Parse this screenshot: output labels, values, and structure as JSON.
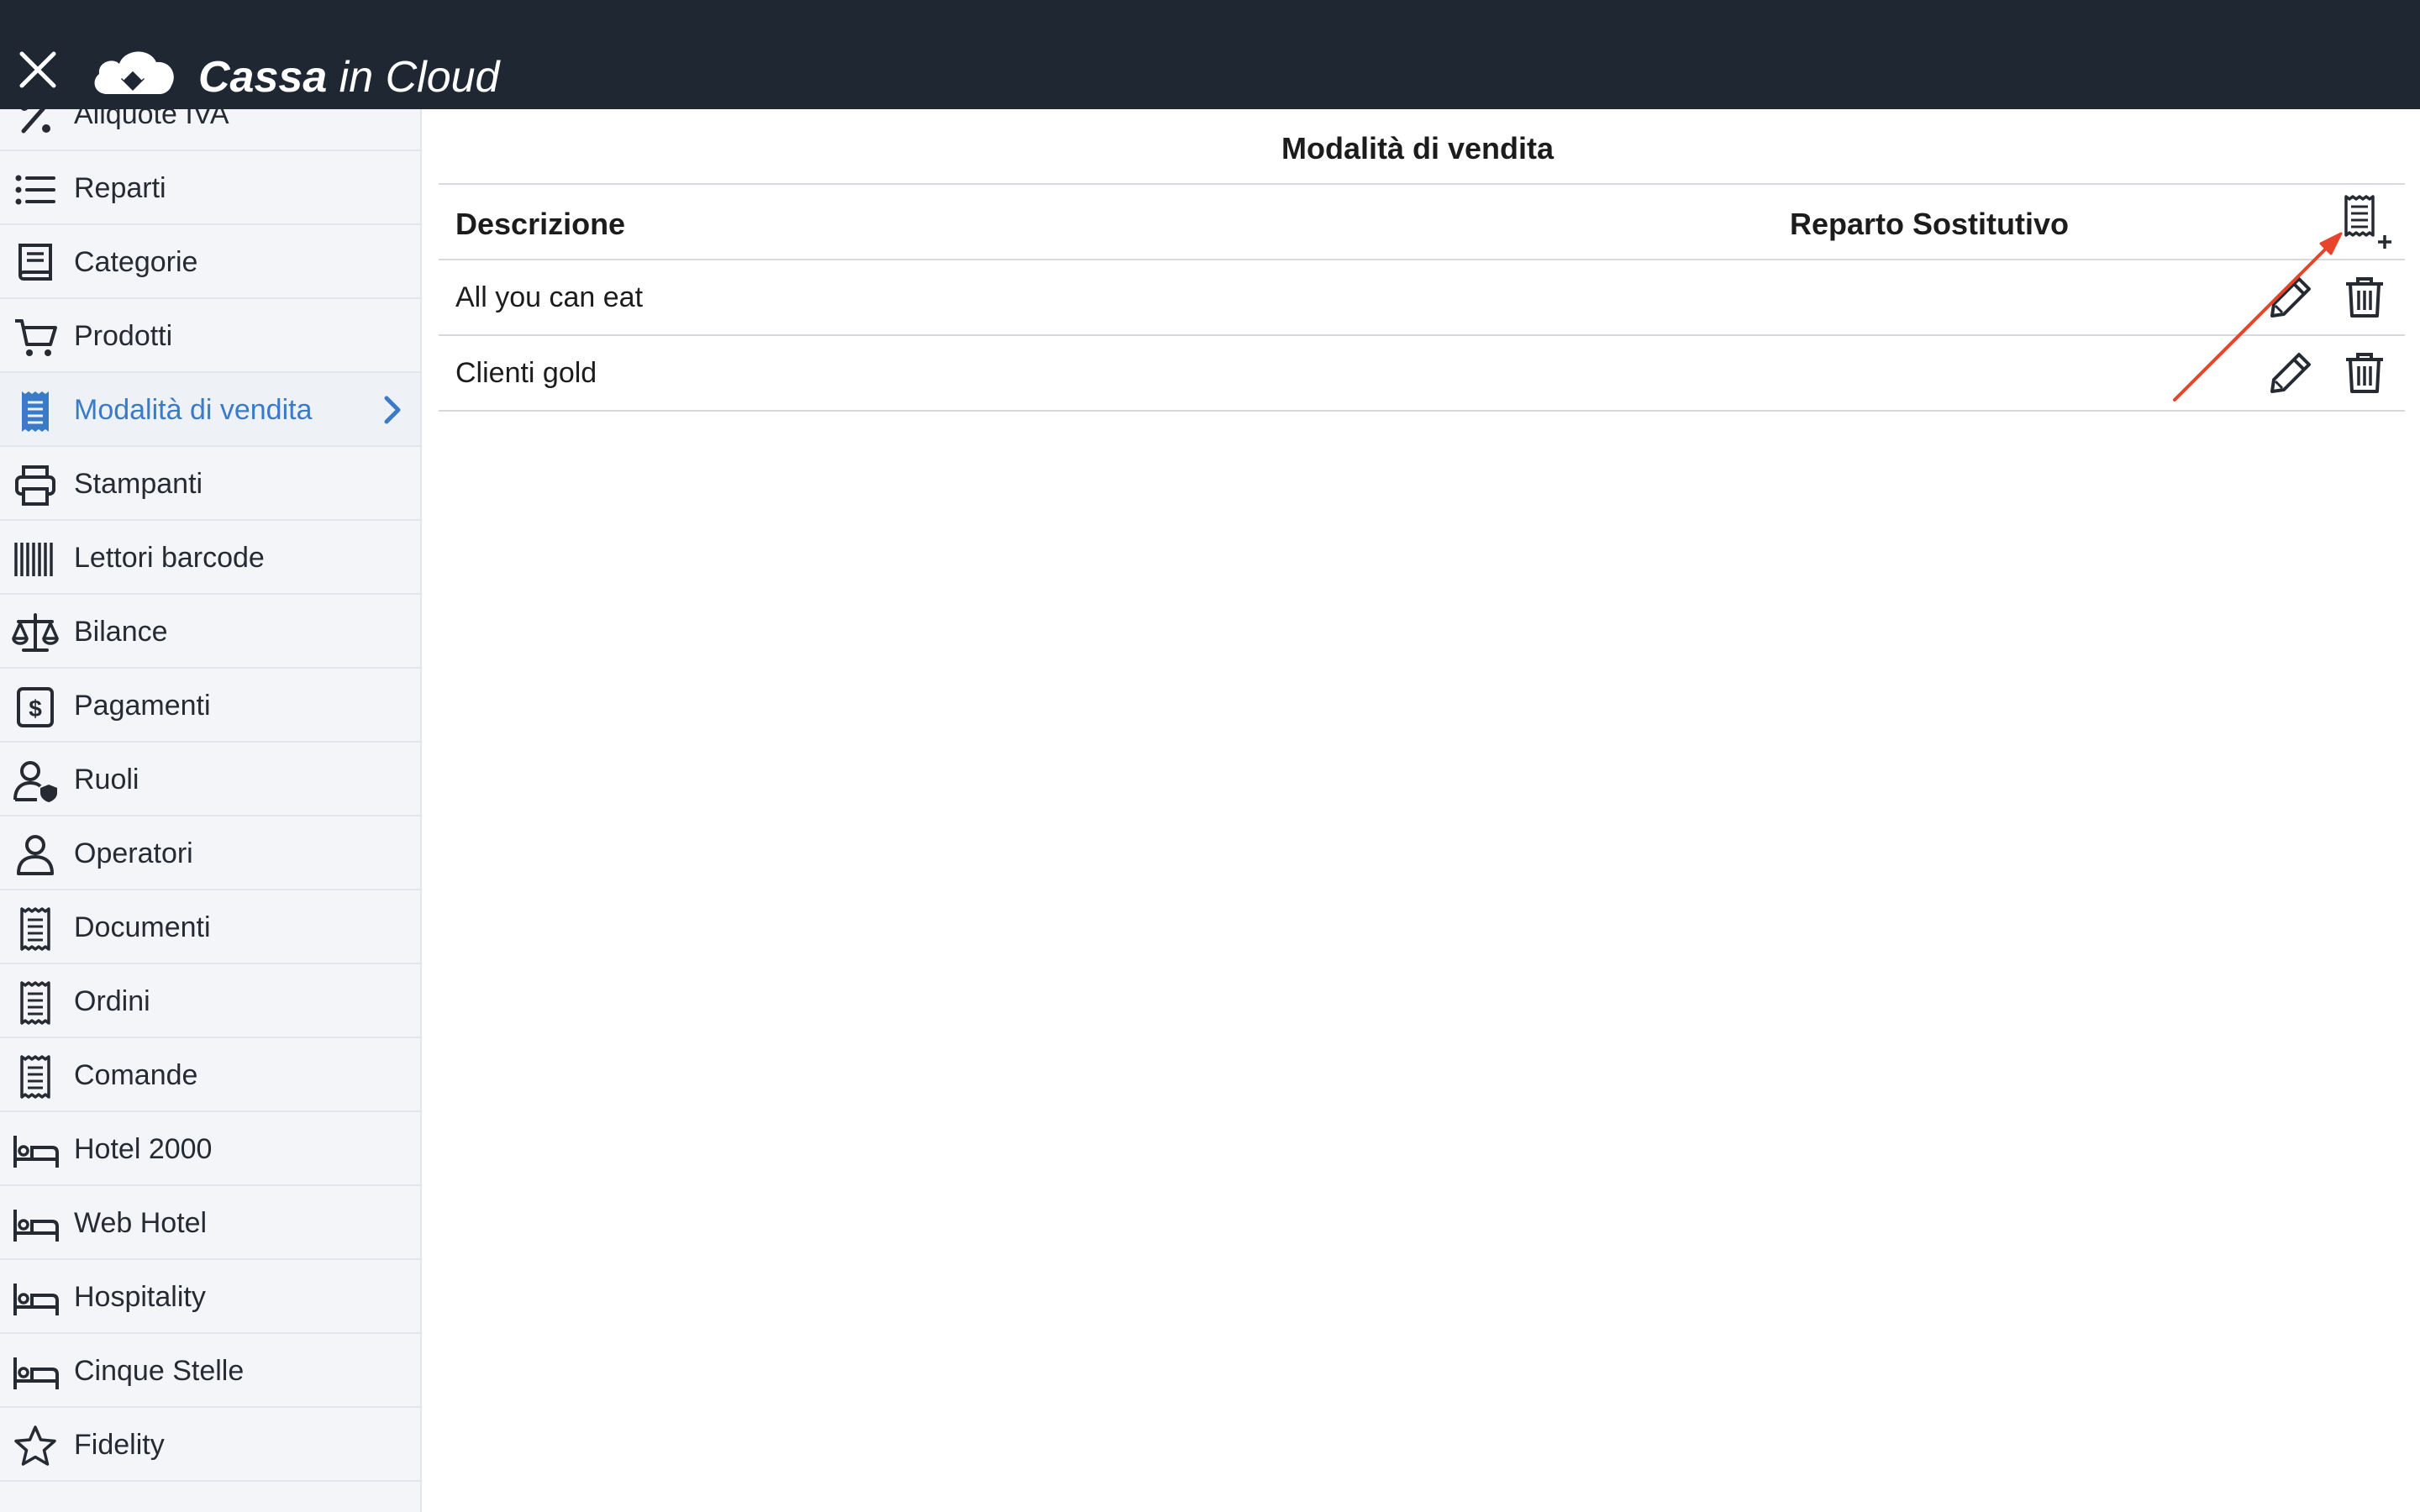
{
  "app": {
    "brand_bold": "Cassa",
    "brand_light": " in Cloud"
  },
  "sidebar": {
    "items": [
      {
        "label": "Aliquote IVA",
        "icon": "percent-icon"
      },
      {
        "label": "Reparti",
        "icon": "list-icon"
      },
      {
        "label": "Categorie",
        "icon": "book-icon"
      },
      {
        "label": "Prodotti",
        "icon": "cart-icon"
      },
      {
        "label": "Modalità di vendita",
        "icon": "receipt-icon",
        "active": true
      },
      {
        "label": "Stampanti",
        "icon": "printer-icon"
      },
      {
        "label": "Lettori barcode",
        "icon": "barcode-icon"
      },
      {
        "label": "Bilance",
        "icon": "scale-icon"
      },
      {
        "label": "Pagamenti",
        "icon": "dollar-icon"
      },
      {
        "label": "Ruoli",
        "icon": "user-shield-icon"
      },
      {
        "label": "Operatori",
        "icon": "user-icon"
      },
      {
        "label": "Documenti",
        "icon": "receipt-icon"
      },
      {
        "label": "Ordini",
        "icon": "receipt-icon"
      },
      {
        "label": "Comande",
        "icon": "receipt-icon"
      },
      {
        "label": "Hotel 2000",
        "icon": "bed-icon"
      },
      {
        "label": "Web Hotel",
        "icon": "bed-icon"
      },
      {
        "label": "Hospitality",
        "icon": "bed-icon"
      },
      {
        "label": "Cinque Stelle",
        "icon": "bed-icon"
      },
      {
        "label": "Fidelity",
        "icon": "star-icon"
      }
    ]
  },
  "main": {
    "title": "Modalità di vendita",
    "table": {
      "headers": {
        "descrizione": "Descrizione",
        "reparto": "Reparto Sostitutivo"
      },
      "rows": [
        {
          "descrizione": "All you can eat",
          "reparto": ""
        },
        {
          "descrizione": "Clienti gold",
          "reparto": ""
        }
      ]
    }
  },
  "colors": {
    "topbar": "#1e2732",
    "sidebar_bg": "#f3f5f8",
    "active_accent": "#3a7bc8",
    "annotation_arrow": "#e8432b"
  }
}
